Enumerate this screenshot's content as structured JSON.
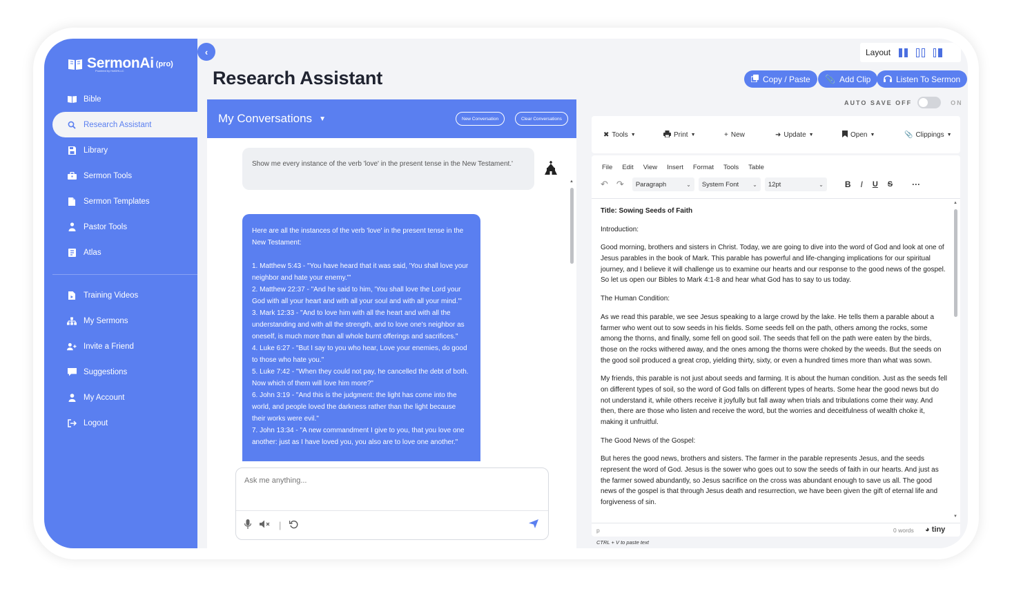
{
  "brand": {
    "name": "SermonAi",
    "badge": "(pro)",
    "tagline": "Powered by HotDHLLC"
  },
  "sidebar": {
    "items": [
      {
        "label": "Bible",
        "icon": "book-icon"
      },
      {
        "label": "Research Assistant",
        "icon": "search-icon"
      },
      {
        "label": "Library",
        "icon": "save-icon"
      },
      {
        "label": "Sermon Tools",
        "icon": "toolbox-icon"
      },
      {
        "label": "Sermon Templates",
        "icon": "file-icon"
      },
      {
        "label": "Pastor Tools",
        "icon": "person-icon"
      },
      {
        "label": "Atlas",
        "icon": "map-icon"
      }
    ],
    "bottom_items": [
      {
        "label": "Training Videos",
        "icon": "video-file-icon"
      },
      {
        "label": "My Sermons",
        "icon": "sitemap-icon"
      },
      {
        "label": "Invite a Friend",
        "icon": "user-plus-icon"
      },
      {
        "label": "Suggestions",
        "icon": "comment-icon"
      },
      {
        "label": "My Account",
        "icon": "user-icon"
      },
      {
        "label": "Logout",
        "icon": "logout-icon"
      }
    ]
  },
  "header": {
    "title": "Research Assistant",
    "layout_label": "Layout",
    "actions": [
      {
        "label": "Copy / Paste",
        "icon": "copy-icon"
      },
      {
        "label": "Add Clip",
        "icon": "paperclip-icon"
      },
      {
        "label": "Listen To Sermon",
        "icon": "headphones-icon"
      }
    ],
    "autosave_label": "AUTO SAVE OFF",
    "autosave_on": "ON"
  },
  "chat": {
    "title": "My Conversations",
    "new_button": "New Conversation",
    "clear_button": "Clear Conversations",
    "user_message": "Show me every instance of the verb 'love' in the present tense in the New Testament.'",
    "bot_message": [
      "Here are all the instances of the verb 'love' in the present tense in the New Testament:",
      "",
      "1. Matthew 5:43 - \"You have heard that it was said, 'You shall love your neighbor and hate your enemy.'\"",
      "2. Matthew 22:37 - \"And he said to him, 'You shall love the Lord your God with all your heart and with all your soul and with all your mind.'\"",
      "3. Mark 12:33 - \"And to love him with all the heart and with all the understanding and with all the strength, and to love one's neighbor as oneself, is much more than all whole burnt offerings and sacrifices.\"",
      "4. Luke 6:27 - \"But I say to you who hear, Love your enemies, do good to those who hate you.\"",
      "5. Luke 7:42 - \"When they could not pay, he cancelled the debt of both. Now which of them will love him more?\"",
      "6. John 3:19 - \"And this is the judgment: the light has come into the world, and people loved the darkness rather than the light because their works were evil.\"",
      "7. John 13:34 - \"A new commandment I give to you, that you love one another: just as I have loved you, you also are to love one another.\""
    ],
    "input_placeholder": "Ask me anything..."
  },
  "editor": {
    "toolbar": [
      {
        "label": "Tools",
        "icon": "tools-icon"
      },
      {
        "label": "Print",
        "icon": "print-icon"
      },
      {
        "label": "New",
        "icon": "plus-icon"
      },
      {
        "label": "Update",
        "icon": "import-icon"
      },
      {
        "label": "Open",
        "icon": "bookmark-icon"
      },
      {
        "label": "Clippings",
        "icon": "paperclip-icon"
      }
    ],
    "menu": [
      "File",
      "Edit",
      "View",
      "Insert",
      "Format",
      "Tools",
      "Table"
    ],
    "block_format": "Paragraph",
    "font": "System Font",
    "size": "12pt",
    "doc": {
      "title": "Title: Sowing Seeds of Faith",
      "paragraphs": [
        "Introduction:",
        "Good morning, brothers and sisters in Christ. Today, we are going to dive into the word of God and look at one of Jesus parables in the book of Mark. This parable has powerful and life-changing implications for our spiritual journey, and I believe it will challenge us to examine our hearts and our response to the good news of the gospel. So let us open our Bibles to Mark 4:1-8 and hear what God has to say to us today.",
        "The Human Condition:",
        "As we read this parable, we see Jesus speaking to a large crowd by the lake. He tells them a parable about a farmer who went out to sow seeds in his fields. Some seeds fell on the path, others among the rocks, some among the thorns, and finally, some fell on good soil. The seeds that fell on the path were eaten by the birds, those on the rocks withered away, and the ones among the thorns were choked by the weeds. But the seeds on the good soil produced a great crop, yielding thirty, sixty, or even a hundred times more than what was sown.",
        "My friends, this parable is not just about seeds and farming. It is about the human condition. Just as the seeds fell on different types of soil, so the word of God falls on different types of hearts. Some hear the good news but do not understand it, while others receive it joyfully but fall away when trials and tribulations come their way. And then, there are those who listen and receive the word, but the worries and deceitfulness of wealth choke it, making it unfruitful.",
        "The Good News of the Gospel:",
        "But heres the good news, brothers and sisters. The farmer in the parable represents Jesus, and the seeds represent the word of God. Jesus is the sower who goes out to sow the seeds of faith in our hearts. And just as the farmer sowed abundantly, so Jesus sacrifice on the cross was abundant enough to save us all. The good news of the gospel is that through Jesus death and resurrection, we have been given the gift of eternal life and forgiveness of sin."
      ]
    },
    "status_path": "p",
    "word_count": "0 words",
    "brand": "tiny",
    "paste_hint": "CTRL + V to paste text"
  }
}
